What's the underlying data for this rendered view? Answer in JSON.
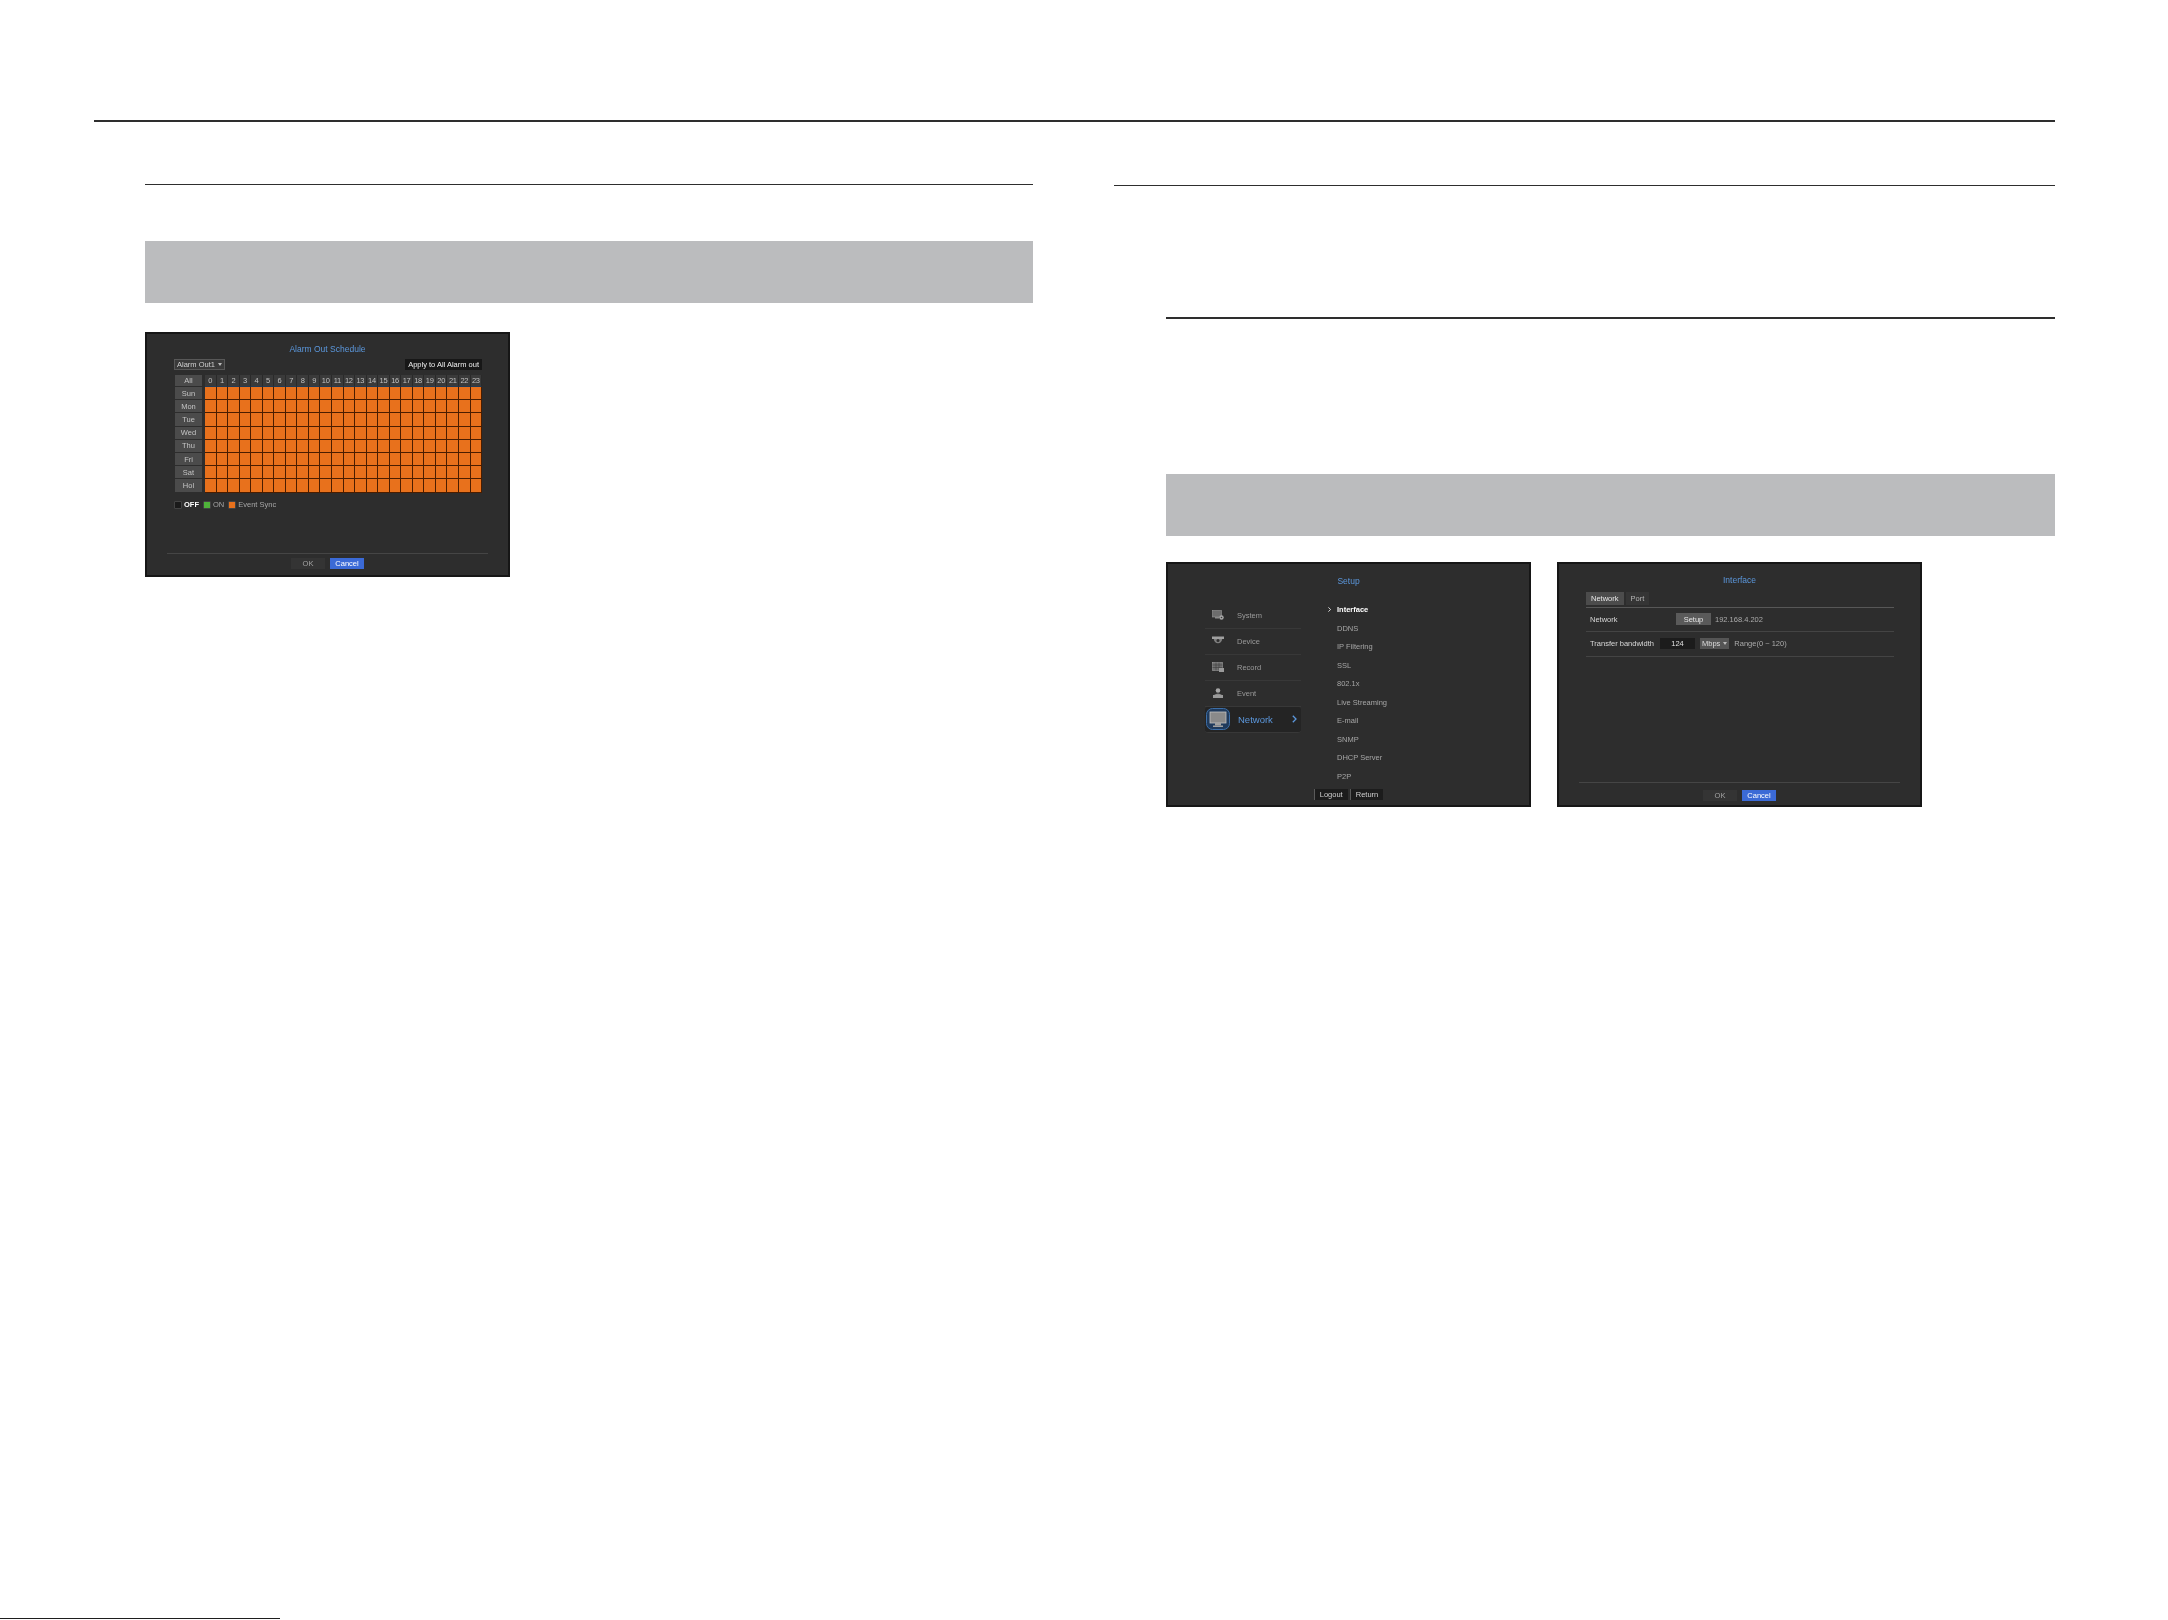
{
  "alarm_out_schedule": {
    "title": "Alarm Out Schedule",
    "alarm_select": {
      "value": "Alarm Out1"
    },
    "apply_button": "Apply to All Alarm out",
    "all_label": "All",
    "hours": [
      "0",
      "1",
      "2",
      "3",
      "4",
      "5",
      "6",
      "7",
      "8",
      "9",
      "10",
      "11",
      "12",
      "13",
      "14",
      "15",
      "16",
      "17",
      "18",
      "19",
      "20",
      "21",
      "22",
      "23"
    ],
    "days": [
      {
        "label": "Sun",
        "cells": [
          {
            "color": "#e8711c"
          },
          {
            "color": "#e8711c"
          },
          {
            "color": "#e8711c"
          },
          {
            "color": "#e8711c"
          },
          {
            "color": "#e8711c"
          },
          {
            "color": "#e8711c"
          },
          {
            "color": "#e8711c"
          },
          {
            "color": "#e8711c"
          },
          {
            "color": "#e8711c"
          },
          {
            "color": "#e8711c"
          },
          {
            "color": "#e8711c"
          },
          {
            "color": "#e8711c"
          },
          {
            "color": "#e8711c"
          },
          {
            "color": "#e8711c"
          },
          {
            "color": "#e8711c"
          },
          {
            "color": "#e8711c"
          },
          {
            "color": "#e8711c"
          },
          {
            "color": "#e8711c"
          },
          {
            "color": "#e8711c"
          },
          {
            "color": "#e8711c"
          },
          {
            "color": "#e8711c"
          },
          {
            "color": "#e8711c"
          },
          {
            "color": "#e8711c"
          },
          {
            "color": "#e8711c"
          }
        ]
      },
      {
        "label": "Mon",
        "cells": [
          {
            "color": "#e8711c"
          },
          {
            "color": "#e8711c"
          },
          {
            "color": "#e8711c"
          },
          {
            "color": "#e8711c"
          },
          {
            "color": "#e8711c"
          },
          {
            "color": "#e8711c"
          },
          {
            "color": "#e8711c"
          },
          {
            "color": "#e8711c"
          },
          {
            "color": "#e8711c"
          },
          {
            "color": "#e8711c"
          },
          {
            "color": "#e8711c"
          },
          {
            "color": "#e8711c"
          },
          {
            "color": "#e8711c"
          },
          {
            "color": "#e8711c"
          },
          {
            "color": "#e8711c"
          },
          {
            "color": "#e8711c"
          },
          {
            "color": "#e8711c"
          },
          {
            "color": "#e8711c"
          },
          {
            "color": "#e8711c"
          },
          {
            "color": "#e8711c"
          },
          {
            "color": "#e8711c"
          },
          {
            "color": "#e8711c"
          },
          {
            "color": "#e8711c"
          },
          {
            "color": "#e8711c"
          }
        ]
      },
      {
        "label": "Tue",
        "cells": [
          {
            "color": "#e8711c"
          },
          {
            "color": "#e8711c"
          },
          {
            "color": "#e8711c"
          },
          {
            "color": "#e8711c"
          },
          {
            "color": "#e8711c"
          },
          {
            "color": "#e8711c"
          },
          {
            "color": "#e8711c"
          },
          {
            "color": "#e8711c"
          },
          {
            "color": "#e8711c"
          },
          {
            "color": "#e8711c"
          },
          {
            "color": "#e8711c"
          },
          {
            "color": "#e8711c"
          },
          {
            "color": "#e8711c"
          },
          {
            "color": "#e8711c"
          },
          {
            "color": "#e8711c"
          },
          {
            "color": "#e8711c"
          },
          {
            "color": "#e8711c"
          },
          {
            "color": "#e8711c"
          },
          {
            "color": "#e8711c"
          },
          {
            "color": "#e8711c"
          },
          {
            "color": "#e8711c"
          },
          {
            "color": "#e8711c"
          },
          {
            "color": "#e8711c"
          },
          {
            "color": "#e8711c"
          }
        ]
      },
      {
        "label": "Wed",
        "cells": [
          {
            "color": "#e8711c"
          },
          {
            "color": "#e8711c"
          },
          {
            "color": "#e8711c"
          },
          {
            "color": "#e8711c"
          },
          {
            "color": "#e8711c"
          },
          {
            "color": "#e8711c"
          },
          {
            "color": "#e8711c"
          },
          {
            "color": "#e8711c"
          },
          {
            "color": "#e8711c"
          },
          {
            "color": "#e8711c"
          },
          {
            "color": "#e8711c"
          },
          {
            "color": "#e8711c"
          },
          {
            "color": "#e8711c"
          },
          {
            "color": "#e8711c"
          },
          {
            "color": "#e8711c"
          },
          {
            "color": "#e8711c"
          },
          {
            "color": "#e8711c"
          },
          {
            "color": "#e8711c"
          },
          {
            "color": "#e8711c"
          },
          {
            "color": "#e8711c"
          },
          {
            "color": "#e8711c"
          },
          {
            "color": "#e8711c"
          },
          {
            "color": "#e8711c"
          },
          {
            "color": "#e8711c"
          }
        ]
      },
      {
        "label": "Thu",
        "cells": [
          {
            "color": "#e8711c"
          },
          {
            "color": "#e8711c"
          },
          {
            "color": "#e8711c"
          },
          {
            "color": "#e8711c"
          },
          {
            "color": "#e8711c"
          },
          {
            "color": "#e8711c"
          },
          {
            "color": "#e8711c"
          },
          {
            "color": "#e8711c"
          },
          {
            "color": "#e8711c"
          },
          {
            "color": "#e8711c"
          },
          {
            "color": "#e8711c"
          },
          {
            "color": "#e8711c"
          },
          {
            "color": "#e8711c"
          },
          {
            "color": "#e8711c"
          },
          {
            "color": "#e8711c"
          },
          {
            "color": "#e8711c"
          },
          {
            "color": "#e8711c"
          },
          {
            "color": "#e8711c"
          },
          {
            "color": "#e8711c"
          },
          {
            "color": "#e8711c"
          },
          {
            "color": "#e8711c"
          },
          {
            "color": "#e8711c"
          },
          {
            "color": "#e8711c"
          },
          {
            "color": "#e8711c"
          }
        ]
      },
      {
        "label": "Fri",
        "cells": [
          {
            "color": "#e8711c"
          },
          {
            "color": "#e8711c"
          },
          {
            "color": "#e8711c"
          },
          {
            "color": "#e8711c"
          },
          {
            "color": "#e8711c"
          },
          {
            "color": "#e8711c"
          },
          {
            "color": "#e8711c"
          },
          {
            "color": "#e8711c"
          },
          {
            "color": "#e8711c"
          },
          {
            "color": "#e8711c"
          },
          {
            "color": "#e8711c"
          },
          {
            "color": "#e8711c"
          },
          {
            "color": "#e8711c"
          },
          {
            "color": "#e8711c"
          },
          {
            "color": "#e8711c"
          },
          {
            "color": "#e8711c"
          },
          {
            "color": "#e8711c"
          },
          {
            "color": "#e8711c"
          },
          {
            "color": "#e8711c"
          },
          {
            "color": "#e8711c"
          },
          {
            "color": "#e8711c"
          },
          {
            "color": "#e8711c"
          },
          {
            "color": "#e8711c"
          },
          {
            "color": "#e8711c"
          }
        ]
      },
      {
        "label": "Sat",
        "cells": [
          {
            "color": "#e8711c"
          },
          {
            "color": "#e8711c"
          },
          {
            "color": "#e8711c"
          },
          {
            "color": "#e8711c"
          },
          {
            "color": "#e8711c"
          },
          {
            "color": "#e8711c"
          },
          {
            "color": "#e8711c"
          },
          {
            "color": "#e8711c"
          },
          {
            "color": "#e8711c"
          },
          {
            "color": "#e8711c"
          },
          {
            "color": "#e8711c"
          },
          {
            "color": "#e8711c"
          },
          {
            "color": "#e8711c"
          },
          {
            "color": "#e8711c"
          },
          {
            "color": "#e8711c"
          },
          {
            "color": "#e8711c"
          },
          {
            "color": "#e8711c"
          },
          {
            "color": "#e8711c"
          },
          {
            "color": "#e8711c"
          },
          {
            "color": "#e8711c"
          },
          {
            "color": "#e8711c"
          },
          {
            "color": "#e8711c"
          },
          {
            "color": "#e8711c"
          },
          {
            "color": "#e8711c"
          }
        ]
      },
      {
        "label": "Hol",
        "cells": [
          {
            "color": "#e8711c"
          },
          {
            "color": "#e8711c"
          },
          {
            "color": "#e8711c"
          },
          {
            "color": "#e8711c"
          },
          {
            "color": "#e8711c"
          },
          {
            "color": "#e8711c"
          },
          {
            "color": "#e8711c"
          },
          {
            "color": "#e8711c"
          },
          {
            "color": "#e8711c"
          },
          {
            "color": "#e8711c"
          },
          {
            "color": "#e8711c"
          },
          {
            "color": "#e8711c"
          },
          {
            "color": "#e8711c"
          },
          {
            "color": "#e8711c"
          },
          {
            "color": "#e8711c"
          },
          {
            "color": "#e8711c"
          },
          {
            "color": "#e8711c"
          },
          {
            "color": "#e8711c"
          },
          {
            "color": "#e8711c"
          },
          {
            "color": "#e8711c"
          },
          {
            "color": "#e8711c"
          },
          {
            "color": "#e8711c"
          },
          {
            "color": "#e8711c"
          },
          {
            "color": "#e8711c"
          }
        ]
      }
    ],
    "legend": [
      {
        "label": "OFF",
        "color": "#1a1a1a",
        "selected": true
      },
      {
        "label": "ON",
        "color": "#4fb23a",
        "selected": false
      },
      {
        "label": "Event Sync",
        "color": "#e8711c",
        "selected": false
      }
    ],
    "buttons": [
      {
        "label": "OK",
        "disabled": true,
        "focused": false
      },
      {
        "label": "Cancel",
        "disabled": false,
        "focused": true
      }
    ]
  },
  "setup_menu": {
    "title": "Setup",
    "categories": [
      {
        "kind": "system",
        "label": "System",
        "selected": false
      },
      {
        "kind": "device",
        "label": "Device",
        "selected": false
      },
      {
        "kind": "record",
        "label": "Record",
        "selected": false
      },
      {
        "kind": "event",
        "label": "Event",
        "selected": false
      },
      {
        "kind": "network",
        "label": "Network",
        "selected": true
      }
    ],
    "submenu": [
      {
        "label": "Interface",
        "selected": true
      },
      {
        "label": "DDNS",
        "selected": false
      },
      {
        "label": "IP Filtering",
        "selected": false
      },
      {
        "label": "SSL",
        "selected": false
      },
      {
        "label": "802.1x",
        "selected": false
      },
      {
        "label": "Live Streaming",
        "selected": false
      },
      {
        "label": "E-mail",
        "selected": false
      },
      {
        "label": "SNMP",
        "selected": false
      },
      {
        "label": "DHCP Server",
        "selected": false
      },
      {
        "label": "P2P",
        "selected": false
      }
    ],
    "buttons": [
      {
        "label": "Logout"
      },
      {
        "label": "Return"
      }
    ]
  },
  "interface_settings": {
    "title": "Interface",
    "tabs": [
      {
        "label": "Network",
        "selected": true
      },
      {
        "label": "Port",
        "selected": false
      }
    ],
    "rows": [
      {
        "kind": "setup",
        "label": "Network",
        "button": "Setup",
        "value": "192.168.4.202"
      },
      {
        "kind": "bandwidth",
        "label": "Transfer bandwidth",
        "field": {
          "value": "124"
        },
        "unit_select": {
          "value": "Mbps"
        },
        "note": "Range(0 ~ 120)"
      }
    ],
    "buttons": [
      {
        "label": "OK",
        "disabled": true,
        "focused": false
      },
      {
        "label": "Cancel",
        "disabled": false,
        "focused": true
      }
    ]
  }
}
